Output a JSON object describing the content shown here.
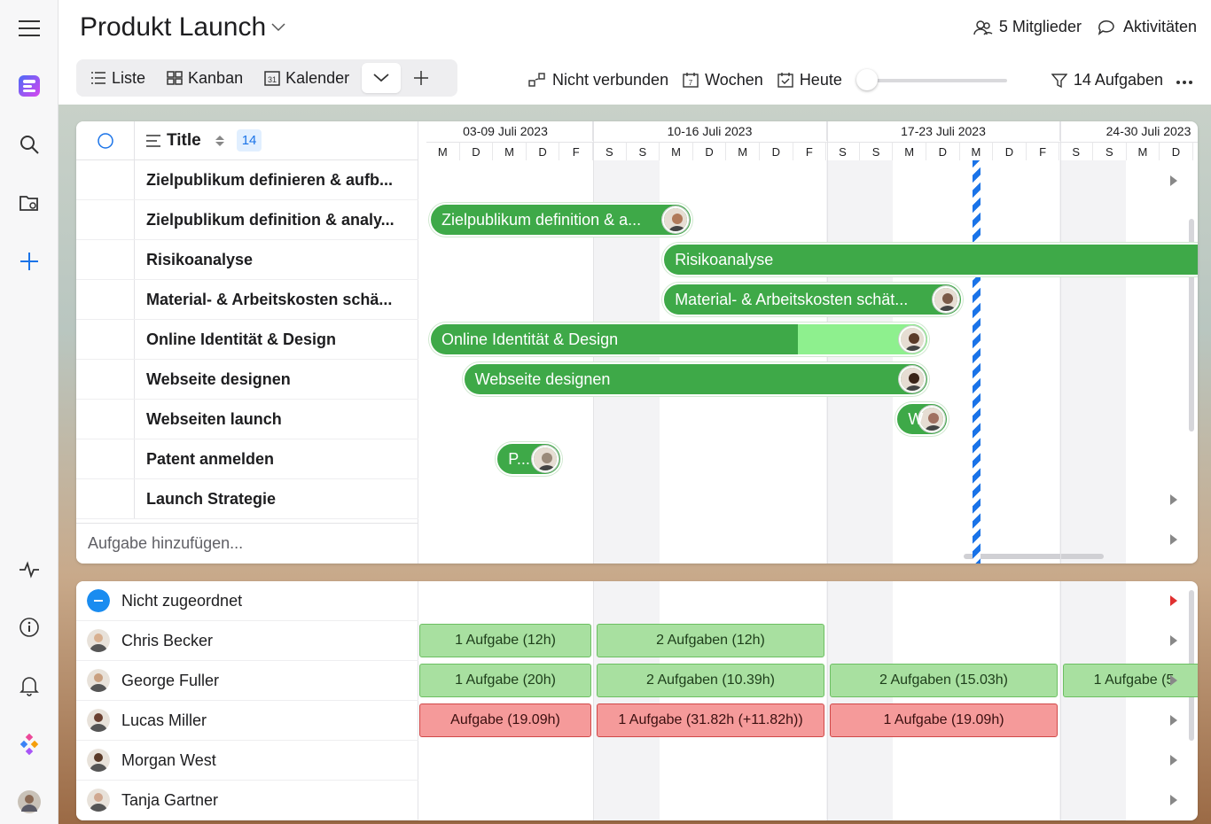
{
  "project": {
    "title": "Produkt Launch"
  },
  "header": {
    "members": "5 Mitglieder",
    "activities": "Aktivitäten"
  },
  "views": [
    {
      "label": "Liste",
      "icon": "list-icon"
    },
    {
      "label": "Kanban",
      "icon": "kanban-icon"
    },
    {
      "label": "Kalender",
      "icon": "calendar-icon"
    }
  ],
  "toolbar": {
    "not_connected": "Nicht verbunden",
    "weeks": "Wochen",
    "today": "Heute",
    "filter": "14 Aufgaben",
    "zoom_level": 0
  },
  "gantt": {
    "title_header": "Title",
    "count": "14",
    "add_task_placeholder": "Aufgabe hinzufügen...",
    "weeks": [
      "03-09 Juli 2023",
      "10-16 Juli 2023",
      "17-23 Juli 2023",
      "24-30 Juli 2023"
    ],
    "days": [
      "M",
      "D",
      "M",
      "D",
      "F",
      "S",
      "S",
      "M",
      "D",
      "M",
      "D",
      "F",
      "S",
      "S",
      "M",
      "D",
      "M",
      "D",
      "F",
      "S",
      "S",
      "M",
      "D",
      "M",
      "D"
    ],
    "tasks": [
      {
        "title": "Zielpublikum definieren & aufb...",
        "bar": ""
      },
      {
        "title": "Zielpublikum definition & analy...",
        "bar": "Zielpublikum definition & a..."
      },
      {
        "title": "Risikoanalyse",
        "bar": "Risikoanalyse"
      },
      {
        "title": "Material- & Arbeitskosten schä...",
        "bar": "Material- & Arbeitskosten schät..."
      },
      {
        "title": "Online Identität & Design",
        "bar": "Online Identität & Design"
      },
      {
        "title": "Webseite designen",
        "bar": "Webseite designen"
      },
      {
        "title": "Webseiten launch",
        "bar": "W"
      },
      {
        "title": "Patent anmelden",
        "bar": "P..."
      },
      {
        "title": "Launch Strategie",
        "bar": ""
      }
    ]
  },
  "workload": {
    "rows": [
      {
        "name": "Nicht zugeordnet",
        "cells": []
      },
      {
        "name": "Chris Becker",
        "cells": [
          "1 Aufgabe (12h)",
          "2 Aufgaben (12h)"
        ]
      },
      {
        "name": "George Fuller",
        "cells": [
          "1 Aufgabe (20h)",
          "2 Aufgaben (10.39h)",
          "2 Aufgaben (15.03h)",
          "1 Aufgabe (5"
        ]
      },
      {
        "name": "Lucas Miller",
        "cells": [
          "Aufgabe (19.09h)",
          "1 Aufgabe (31.82h (+11.82h))",
          "1 Aufgabe (19.09h)"
        ]
      },
      {
        "name": "Morgan West",
        "cells": []
      },
      {
        "name": "Tanja Gartner",
        "cells": []
      }
    ]
  },
  "colors": {
    "bar": "#3ea948",
    "bar_light": "#8ef08e",
    "over": "#f59a9a",
    "ok": "#a8e0a0",
    "today": "#1a73e8"
  }
}
